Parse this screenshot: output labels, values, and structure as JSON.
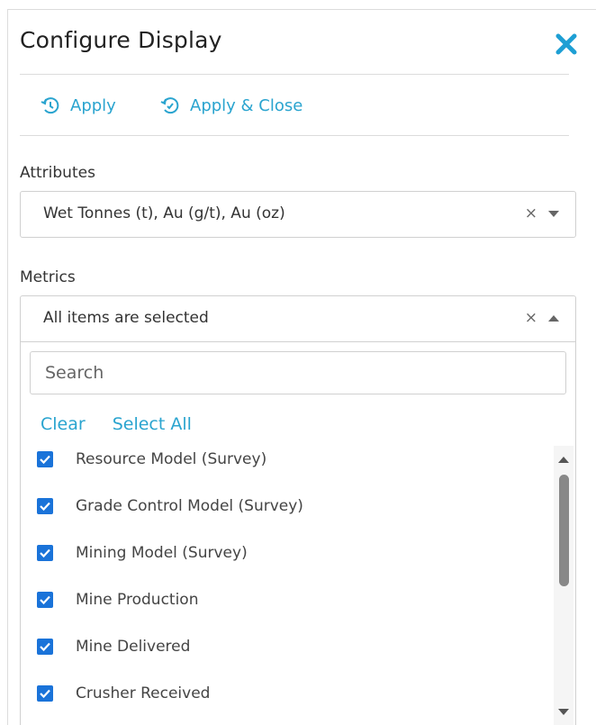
{
  "dialog": {
    "title": "Configure Display"
  },
  "actions": {
    "apply_label": "Apply",
    "apply_close_label": "Apply & Close"
  },
  "attributes": {
    "label": "Attributes",
    "value": "Wet Tonnes (t), Au (g/t), Au (oz)",
    "clear": "×"
  },
  "metrics": {
    "label": "Metrics",
    "value": "All items are selected",
    "clear": "×",
    "search_placeholder": "Search",
    "clear_link": "Clear",
    "select_all_link": "Select All",
    "items": [
      {
        "label": "Resource Model (Survey)",
        "checked": true
      },
      {
        "label": "Grade Control Model (Survey)",
        "checked": true
      },
      {
        "label": "Mining Model (Survey)",
        "checked": true
      },
      {
        "label": "Mine Production",
        "checked": true
      },
      {
        "label": "Mine Delivered",
        "checked": true
      },
      {
        "label": "Crusher Received",
        "checked": true
      }
    ]
  },
  "colors": {
    "accent": "#2aa4cf",
    "checkbox": "#1a73d9",
    "close_icon": "#1e9fd4"
  },
  "icons": {
    "close": "close-icon",
    "refresh": "refresh-icon",
    "checkbox": "checkmark-icon"
  }
}
